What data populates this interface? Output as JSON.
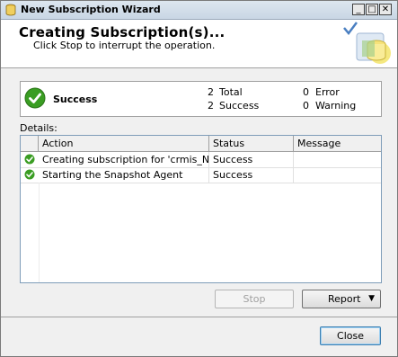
{
  "window": {
    "title": "New Subscription Wizard",
    "minimize_glyph": "_",
    "maximize_glyph": "□",
    "close_glyph": "✕"
  },
  "header": {
    "title": "Creating Subscription(s)...",
    "subtitle": "Click Stop to interrupt the operation."
  },
  "summary": {
    "status": "Success",
    "total_count": "2",
    "total_label": "Total",
    "success_count": "2",
    "success_label": "Success",
    "error_count": "0",
    "error_label": "Error",
    "warning_count": "0",
    "warning_label": "Warning"
  },
  "details": {
    "label": "Details:",
    "columns": [
      "Action",
      "Status",
      "Message"
    ],
    "rows": [
      {
        "action": "Creating subscription for 'crmis_NG\\CR...",
        "status": "Success",
        "message": ""
      },
      {
        "action": "Starting the Snapshot Agent",
        "status": "Success",
        "message": ""
      }
    ]
  },
  "buttons": {
    "stop": "Stop",
    "report": "Report",
    "report_arrow": "▼",
    "close": "Close"
  },
  "colors": {
    "success_green": "#3a9d23",
    "title_bar": "#c9d6e4"
  }
}
